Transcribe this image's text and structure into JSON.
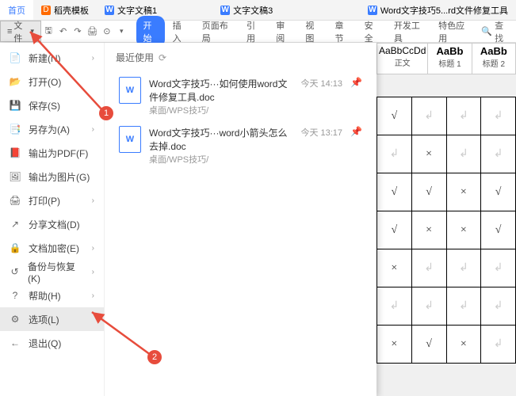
{
  "tabs": {
    "home": "首页",
    "t1": "稻壳模板",
    "t2": "文字文稿1",
    "t3": "文字文稿3",
    "t4": "Word文字技巧5...rd文件修复工具"
  },
  "toolbar": {
    "file": "文件",
    "menus": [
      "开始",
      "插入",
      "页面布局",
      "引用",
      "审阅",
      "视图",
      "章节",
      "安全",
      "开发工具",
      "特色应用"
    ],
    "search": "查找"
  },
  "file_menu": {
    "items": [
      {
        "label": "新建(N)",
        "chev": true,
        "icon": "new"
      },
      {
        "label": "打开(O)",
        "chev": false,
        "icon": "open"
      },
      {
        "label": "保存(S)",
        "chev": false,
        "icon": "save"
      },
      {
        "label": "另存为(A)",
        "chev": true,
        "icon": "saveas"
      },
      {
        "label": "输出为PDF(F)",
        "chev": false,
        "icon": "pdf"
      },
      {
        "label": "输出为图片(G)",
        "chev": false,
        "icon": "img"
      },
      {
        "label": "打印(P)",
        "chev": true,
        "icon": "print"
      },
      {
        "label": "分享文档(D)",
        "chev": false,
        "icon": "share"
      },
      {
        "label": "文档加密(E)",
        "chev": true,
        "icon": "lock"
      },
      {
        "label": "备份与恢复(K)",
        "chev": true,
        "icon": "backup"
      },
      {
        "label": "帮助(H)",
        "chev": true,
        "icon": "help"
      },
      {
        "label": "选项(L)",
        "chev": false,
        "icon": "options",
        "hl": true
      },
      {
        "label": "退出(Q)",
        "chev": false,
        "icon": "exit"
      }
    ]
  },
  "recent": {
    "header": "最近使用",
    "items": [
      {
        "title": "Word文字技巧···如何使用word文件修复工具.doc",
        "path": "桌面/WPS技巧/",
        "time": "今天 14:13"
      },
      {
        "title": "Word文字技巧···word小箭头怎么去掉.doc",
        "path": "桌面/WPS技巧/",
        "time": "今天 13:17"
      }
    ]
  },
  "styles": [
    {
      "sample": "AaBbCcDd",
      "name": "正文",
      "bold": false
    },
    {
      "sample": "AaBb",
      "name": "标题 1",
      "bold": true
    },
    {
      "sample": "AaBb",
      "name": "标题 2",
      "bold": true
    }
  ],
  "table": [
    [
      "√",
      "",
      "",
      ""
    ],
    [
      "",
      "×",
      "",
      ""
    ],
    [
      "√",
      "√",
      "×",
      "√"
    ],
    [
      "√",
      "×",
      "×",
      "√"
    ],
    [
      "×",
      "",
      "",
      ""
    ],
    [
      "",
      "",
      "",
      ""
    ],
    [
      "×",
      "√",
      "×",
      ""
    ]
  ],
  "annotations": {
    "a1": "1",
    "a2": "2"
  }
}
